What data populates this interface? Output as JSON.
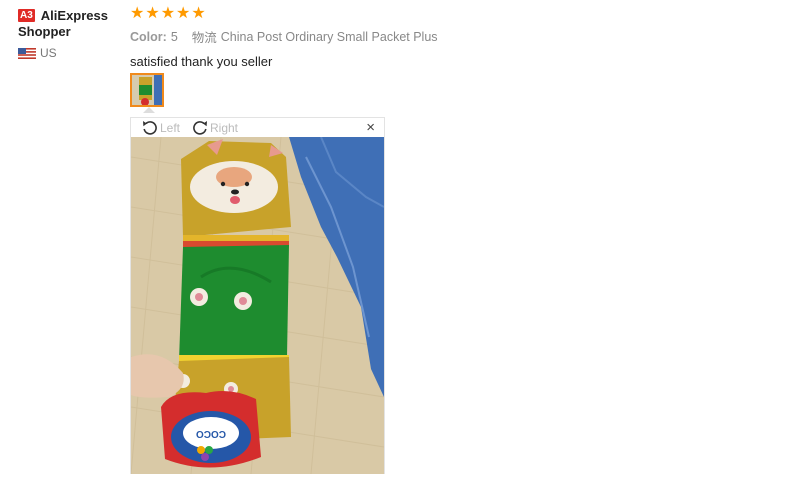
{
  "reviewer": {
    "badge": "A3",
    "name_line1": "AliExpress",
    "name_line2": "Shopper",
    "country": "US"
  },
  "review": {
    "rating": 5,
    "stars": [
      "★",
      "★",
      "★",
      "★",
      "★"
    ],
    "color_label": "Color:",
    "color_value": "5",
    "logistics_label": "物流",
    "logistics_value": "China Post Ordinary Small Packet Plus",
    "comment": "satisfied thank you seller"
  },
  "viewer": {
    "rotate_left_label": "Left",
    "rotate_right_label": "Right",
    "close_glyph": "×",
    "package_text": "COCO"
  },
  "colors": {
    "star": "#ff9a00",
    "badge": "#e02b27",
    "thumb_border": "#f08a1c",
    "sock_green": "#1e8c2f",
    "sock_yellow": "#c8a22a",
    "denim": "#3f6fb6"
  },
  "icons": [
    "rotate-left-icon",
    "rotate-right-icon",
    "close-icon",
    "us-flag-icon",
    "star-icon"
  ]
}
